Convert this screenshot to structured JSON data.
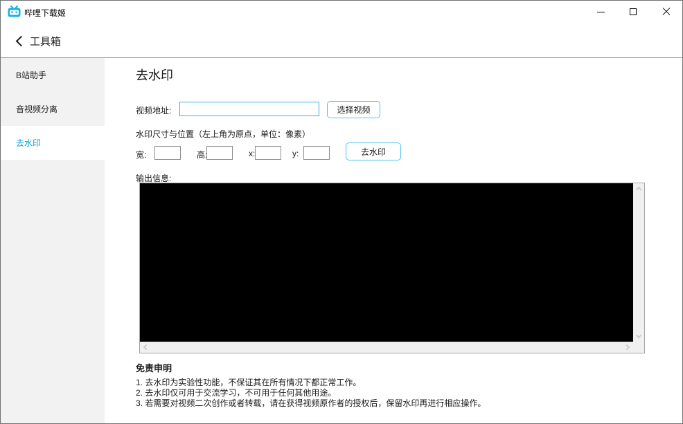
{
  "window": {
    "app_title": "哔哩下载姬",
    "controls": {
      "minimize": "minimize-icon",
      "maximize": "maximize-icon",
      "close": "close-icon"
    }
  },
  "header": {
    "back_icon": "chevron-left-icon",
    "title": "工具箱"
  },
  "sidebar": {
    "items": [
      {
        "label": "B站助手",
        "active": false
      },
      {
        "label": "音视频分离",
        "active": false
      },
      {
        "label": "去水印",
        "active": true
      }
    ]
  },
  "main": {
    "title": "去水印",
    "video_row": {
      "label": "视频地址:",
      "input_value": "",
      "select_button": "选择视频"
    },
    "watermark_hint": "水印尺寸与位置（左上角为原点，单位：像素）",
    "size_fields": [
      {
        "label": "宽:",
        "value": ""
      },
      {
        "label": "高:",
        "value": ""
      },
      {
        "label": "x:",
        "value": ""
      },
      {
        "label": "y:",
        "value": ""
      }
    ],
    "remove_button": "去水印",
    "output": {
      "label": "输出信息:",
      "content": ""
    },
    "disclaimer": {
      "title": "免责申明",
      "lines": [
        "1. 去水印为实验性功能，不保证其在所有情况下都正常工作。",
        "2. 去水印仅可用于交流学习，不可用于任何其他用途。",
        "3. 若需要对视频二次创作或者转载，请在获得视频原作者的授权后，保留水印再进行相应操作。"
      ]
    }
  },
  "colors": {
    "accent_blue": "#00a1d6",
    "brand_icon_blue": "#14b3e6",
    "input_border_blue": "#3fa8de",
    "button_border_blue": "#55c0ea",
    "sidebar_bg": "#f2f2f2",
    "scrollbar_track": "#f0f0f0",
    "output_bg": "#000000",
    "separator": "#8c8c8c"
  }
}
